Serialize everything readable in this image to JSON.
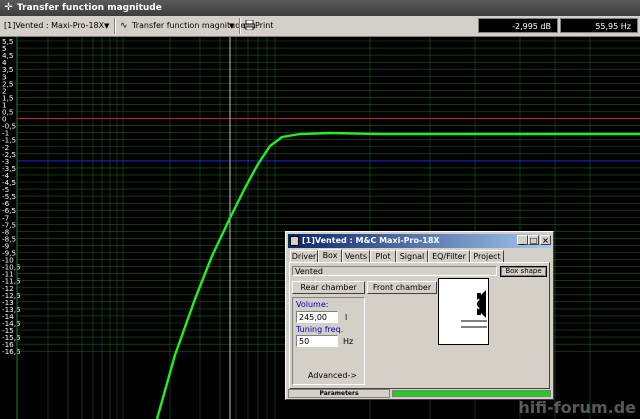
{
  "window": {
    "title": "Transfer function magnitude",
    "icon": "crosshair-icon"
  },
  "toolbar": {
    "project_select": "[1]Vented : Maxi-Pro-18X",
    "plot_select": "Transfer function magnitude",
    "plot_icon": "wave-icon",
    "print_label": "Print",
    "print_icon": "printer-icon",
    "readout_db": "-2,995 dB",
    "readout_hz": "55,95 Hz"
  },
  "plot": {
    "background": "#000000",
    "grid_color": "#1f5a1f",
    "curve_color": "#22ee22",
    "ref_line_0_color": "#d02020",
    "ref_line_minus3_color": "#2020d0",
    "cursor_color": "#c0c0c0",
    "y_ticks": [
      "5,5",
      "5",
      "4,5",
      "4",
      "3,5",
      "3",
      "2,5",
      "2",
      "1,5",
      "1",
      "0,5",
      "0",
      "-0,5",
      "-1",
      "-1,5",
      "-2",
      "-2,5",
      "-3",
      "-3,5",
      "-4",
      "-4,5",
      "-5",
      "-5,5",
      "-6",
      "-6,5",
      "-7",
      "-7,5",
      "-8",
      "-8,5",
      "-9",
      "-9,5",
      "-10",
      "-10,5",
      "-11",
      "-11,5",
      "-12",
      "-12,5",
      "-13",
      "-13,5",
      "-14",
      "-14,5",
      "-15",
      "-15,5",
      "-16",
      "-16,5"
    ]
  },
  "dialog": {
    "title": "[1]Vented : M&C Maxi-Pro-18X",
    "tabs": [
      "Driver",
      "Box",
      "Vents",
      "Plot",
      "Signal",
      "EQ/Filter",
      "Project"
    ],
    "active_tab": "Box",
    "box_type": "Vented",
    "box_shape_button": "Box shape",
    "rear_chamber": "Rear chamber",
    "front_chamber": "Front chamber",
    "volume_label": "Volume:",
    "volume_value": "245,00",
    "volume_unit": "l",
    "tuning_label": "Tuning freq.",
    "tuning_value": "50",
    "tuning_unit": "Hz",
    "advanced": "Advanced->",
    "status_label": "Parameters",
    "status_color": "#22cc22"
  },
  "watermark": "hifi-forum.de"
}
